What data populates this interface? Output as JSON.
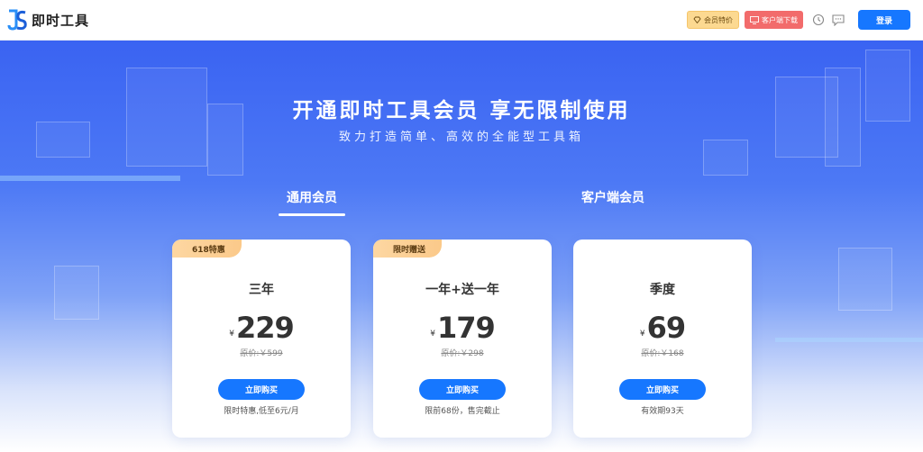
{
  "header": {
    "app_name": "即时工具",
    "vip_label": "会员特价",
    "client_label": "客户端下载",
    "history_icon": "history-icon",
    "message_icon": "message-icon",
    "login_label": "登录",
    "colors": {
      "accent": "#1677ff",
      "vip_bg": "#fcd991",
      "client_bg": "#f26b6b"
    }
  },
  "hero": {
    "title": "开通即时工具会员 享无限制使用",
    "subtitle": "致力打造简单、高效的全能型工具箱"
  },
  "tabs": [
    {
      "label": "通用会员",
      "active": true
    },
    {
      "label": "客户端会员",
      "active": false
    }
  ],
  "plans": [
    {
      "badge": "618特惠",
      "name": "三年",
      "currency": "¥",
      "price": "229",
      "original": "原价:￥599",
      "button": "立即购买",
      "note": "限时特惠,低至6元/月"
    },
    {
      "badge": "限时赠送",
      "name": "一年+送一年",
      "currency": "¥",
      "price": "179",
      "original": "原价:￥298",
      "button": "立即购买",
      "note": "限前68份，售完截止"
    },
    {
      "badge": "",
      "name": "季度",
      "currency": "¥",
      "price": "69",
      "original": "原价:￥168",
      "button": "立即购买",
      "note": "有效期93天"
    }
  ]
}
